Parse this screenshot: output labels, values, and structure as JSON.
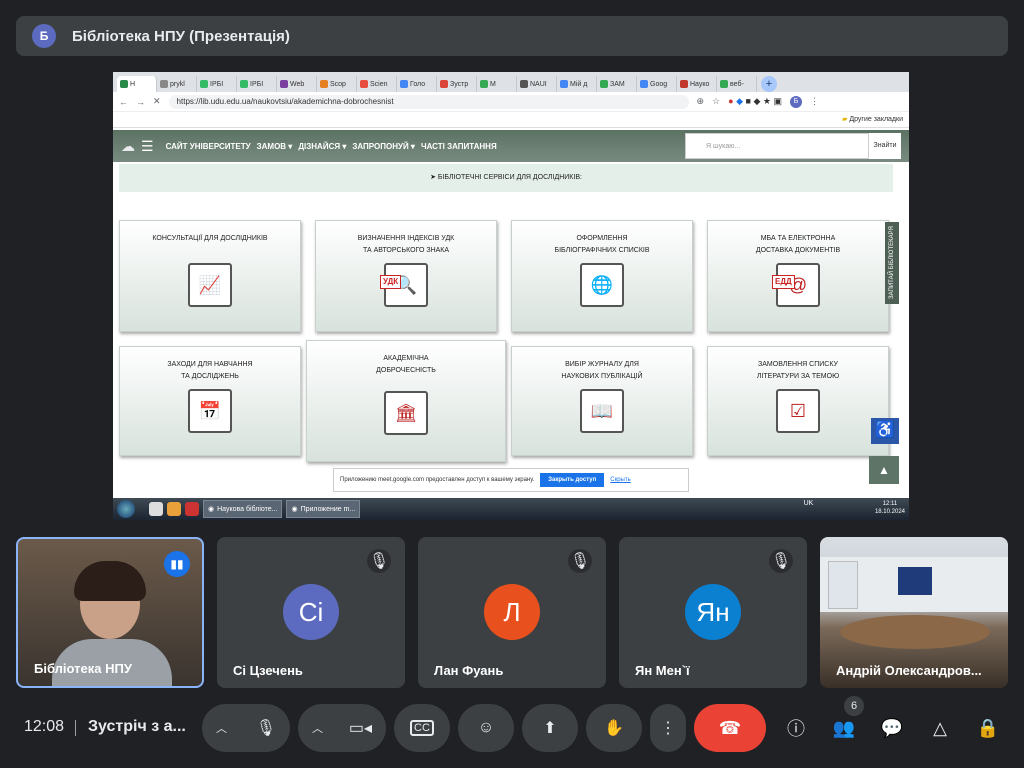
{
  "presenter": {
    "initial": "Б",
    "title": "Бібліотека НПУ (Презентація)"
  },
  "browser": {
    "tabs": [
      {
        "label": "Н",
        "color": "#2a8a4a"
      },
      {
        "label": "prykl",
        "color": "#888"
      },
      {
        "label": "ІРБІ",
        "color": "#3b6"
      },
      {
        "label": "ІРБІ",
        "color": "#3b6"
      },
      {
        "label": "Web",
        "color": "#7b3fa0"
      },
      {
        "label": "Scop",
        "color": "#e67e22"
      },
      {
        "label": "Scien",
        "color": "#e74c3c"
      },
      {
        "label": "Голо",
        "color": "#4285f4"
      },
      {
        "label": "Зустр",
        "color": "#db4437"
      },
      {
        "label": "M",
        "color": "#34a853"
      },
      {
        "label": "NAUI",
        "color": "#555"
      },
      {
        "label": "Мій д",
        "color": "#4285f4"
      },
      {
        "label": "ЗАМ",
        "color": "#34a853"
      },
      {
        "label": "Goog",
        "color": "#4285f4"
      },
      {
        "label": "Науко",
        "color": "#c0392b"
      },
      {
        "label": "веб-",
        "color": "#34a853"
      }
    ],
    "url": "https://lib.udu.edu.ua/naukovtsiu/akademichna-dobrochesnist",
    "bookmarks_folder": "Другие закладки"
  },
  "site": {
    "nav": [
      "САЙТ УНІВЕРСИТЕТУ",
      "ЗАМОВ ▾",
      "ДІЗНАЙСЯ ▾",
      "ЗАПРОПОНУЙ ▾",
      "ЧАСТІ ЗАПИТАННЯ"
    ],
    "search_placeholder": "Я шукаю...",
    "search_button": "Знайти",
    "section_title": "➤ БІБЛІОТЕЧНІ СЕРВІСИ ДЛЯ ДОСЛІДНИКІВ:",
    "cards": [
      {
        "l1": "КОНСУЛЬТАЦІЇ ДЛЯ ДОСЛІДНИКІВ",
        "l2": "",
        "icon": "chart-icon"
      },
      {
        "l1": "ВИЗНАЧЕННЯ ІНДЕКСІВ УДК",
        "l2": "ТА АВТОРСЬКОГО ЗНАКА",
        "icon": "udk-icon",
        "badge": "УДК"
      },
      {
        "l1": "ОФОРМЛЕННЯ",
        "l2": "БІБЛІОГРАФІЧНИХ СПИСКІВ",
        "icon": "document-www-icon"
      },
      {
        "l1": "МБА ТА ЕЛЕКТРОННА",
        "l2": "ДОСТАВКА ДОКУМЕНТІВ",
        "icon": "edd-icon",
        "badge": "ЕДД"
      },
      {
        "l1": "ЗАХОДИ ДЛЯ НАВЧАННЯ",
        "l2": "ТА ДОСЛІДЖЕНЬ",
        "icon": "calendar-monitor-icon"
      },
      {
        "l1": "АКАДЕМІЧНА",
        "l2": "ДОБРОЧЕСНІСТЬ",
        "icon": "university-icon"
      },
      {
        "l1": "ВИБІР ЖУРНАЛУ ДЛЯ",
        "l2": "НАУКОВИХ ПУБЛІКАЦІЙ",
        "icon": "journal-icon"
      },
      {
        "l1": "ЗАМОВЛЕННЯ СПИСКУ",
        "l2": "ЛІТЕРАТУРИ ЗА ТЕМОЮ",
        "icon": "checklist-icon"
      }
    ],
    "side_button": "ЗАПИТАЙ БІБЛІОТЕКАРЯ",
    "notice": {
      "text": "Приложению meet.google.com предоставлен доступ к вашему экрану.",
      "stop": "Закрыть доступ",
      "hide": "Скрыть"
    }
  },
  "taskbar": {
    "items": [
      "Наукова бібліоте...",
      "Приложение m..."
    ],
    "lang": "UK",
    "time": "12:11",
    "date": "18.10.2024"
  },
  "participants": [
    {
      "name": "Бібліотека НПУ",
      "speaking": true
    },
    {
      "name": "Сі Цзечень",
      "initials": "Сі",
      "color": "#5c6bc0"
    },
    {
      "name": "Лан Фуань",
      "initials": "Л",
      "color": "#e8501e"
    },
    {
      "name": "Ян Мен`ї",
      "initials": "Ян",
      "color": "#0b7fd0"
    },
    {
      "name": "Андрій Олександров..."
    }
  ],
  "bottom": {
    "time": "12:08",
    "meeting": "Зустріч з а...",
    "people_count": "6"
  }
}
